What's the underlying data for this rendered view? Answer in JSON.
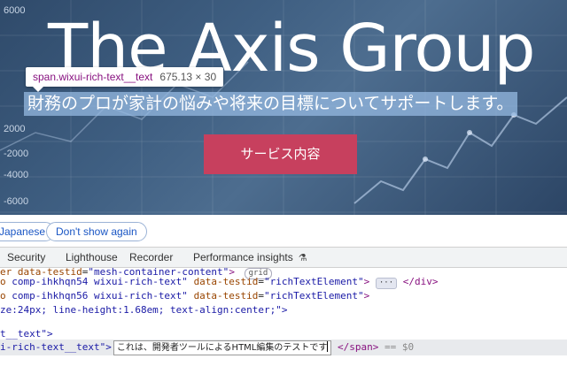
{
  "hero": {
    "title": "The Axis Group",
    "tagline": "財務のプロが家計の悩みや将来の目標についてサポートします。",
    "cta_label": "サービス内容",
    "axis_ticks": [
      "6000",
      "2000",
      "-2000",
      "-4000",
      "-6000"
    ]
  },
  "inspect_tooltip": {
    "selector": "span.wixui-rich-text__text",
    "dimensions": "675.13 × 30"
  },
  "translate_bar": {
    "language_button": "Japanese",
    "dont_show_button": "Don't show again"
  },
  "devtools": {
    "tabs": [
      "Security",
      "Lighthouse",
      "Recorder",
      "Performance insights"
    ],
    "lines": {
      "l1_prefix": "er",
      "l1_attr": "data-testid",
      "l1_val": "\"mesh-container-content\"",
      "l1_close": ">",
      "l1_badge": "grid",
      "l2_prefix": "o",
      "l2_attr_text": "comp-ihkhqn54 wixui-rich-text\"",
      "l2_attr2": "data-testid",
      "l2_val2": "\"richTextElement\"",
      "l2_gt": ">",
      "l2_dots": "···",
      "l2_close": "</div>",
      "l3_prefix": "o",
      "l3_attr_text": "comp-ihkhqn56 wixui-rich-text\"",
      "l3_attr2": "data-testid",
      "l3_val2": "\"richTextElement\"",
      "l3_gt": ">",
      "l4_text": "ze:24px; line-height:1.68em; text-align:center;\">",
      "l5_text": "t__text\">",
      "l6_prefix": "i-rich-text__text\">",
      "l6_edit": "これは、開発者ツールによるHTML編集のテストです",
      "l6_close": "</span>",
      "l6_eq": "== $0"
    }
  }
}
